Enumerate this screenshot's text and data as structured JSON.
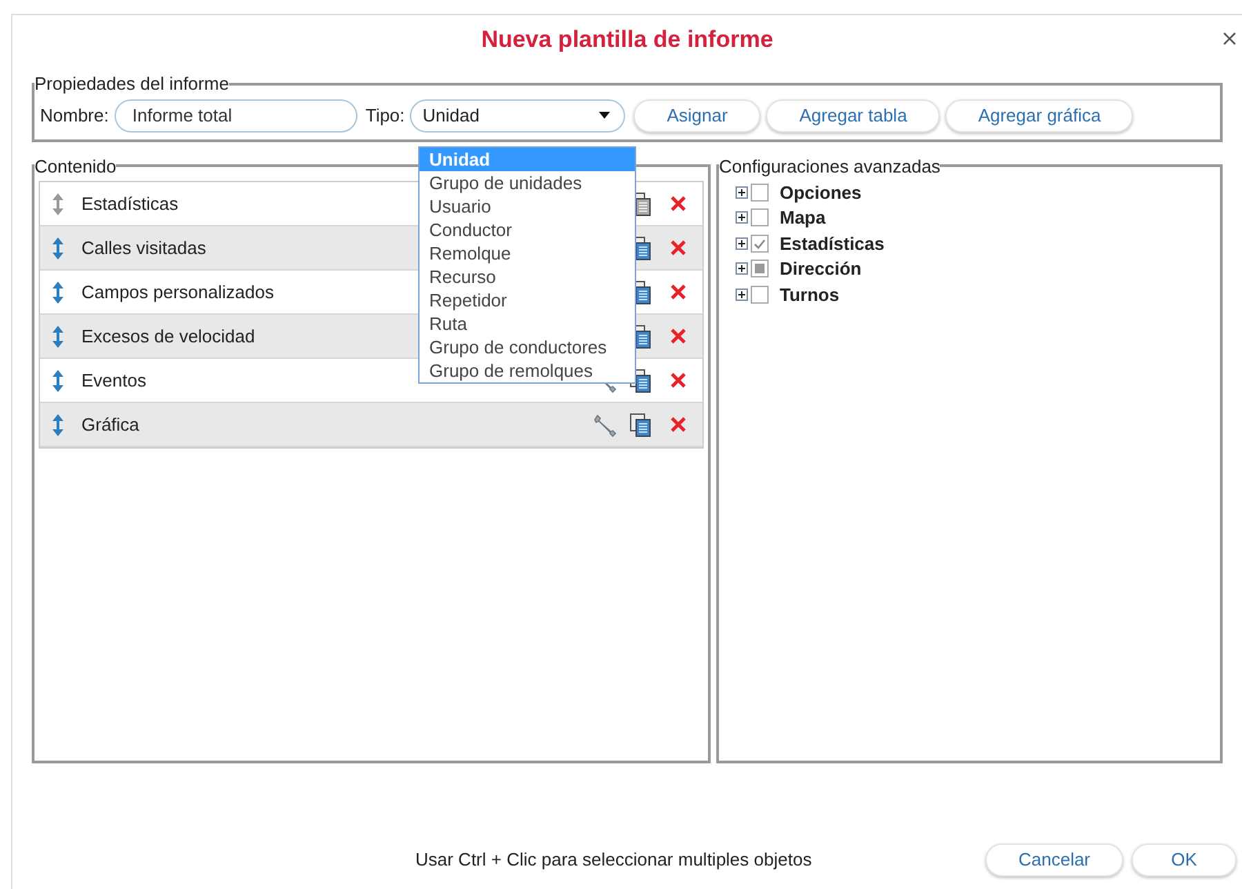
{
  "window": {
    "title": "Nueva plantilla de informe"
  },
  "properties": {
    "legend": "Propiedades del informe",
    "name_label": "Nombre:",
    "name_value": "Informe total",
    "type_label": "Tipo:",
    "type_value": "Unidad",
    "buttons": [
      "Asignar",
      "Agregar tabla",
      "Agregar gráfica"
    ]
  },
  "type_dropdown": {
    "expanded": true,
    "options": [
      {
        "label": "Unidad",
        "selected": true
      },
      {
        "label": "Grupo de unidades",
        "selected": false
      },
      {
        "label": "Usuario",
        "selected": false
      },
      {
        "label": "Conductor",
        "selected": false
      },
      {
        "label": "Remolque",
        "selected": false
      },
      {
        "label": "Recurso",
        "selected": false
      },
      {
        "label": "Repetidor",
        "selected": false
      },
      {
        "label": "Ruta",
        "selected": false
      },
      {
        "label": "Grupo de conductores",
        "selected": false
      },
      {
        "label": "Grupo de remolques",
        "selected": false
      }
    ]
  },
  "content": {
    "legend": "Contenido",
    "items": [
      {
        "label": "Estadísticas",
        "movable": false
      },
      {
        "label": "Calles visitadas",
        "movable": true
      },
      {
        "label": "Campos personalizados",
        "movable": true
      },
      {
        "label": "Excesos de velocidad",
        "movable": true
      },
      {
        "label": "Eventos",
        "movable": true
      },
      {
        "label": "Gráfica",
        "movable": true
      }
    ]
  },
  "advanced": {
    "legend": "Configuraciones avanzadas",
    "items": [
      {
        "label": "Opciones",
        "checked": false,
        "indeterminate": false
      },
      {
        "label": "Mapa",
        "checked": false,
        "indeterminate": false
      },
      {
        "label": "Estadísticas",
        "checked": true,
        "indeterminate": false
      },
      {
        "label": "Dirección",
        "checked": false,
        "indeterminate": true
      },
      {
        "label": "Turnos",
        "checked": false,
        "indeterminate": false
      }
    ]
  },
  "footer": {
    "hint": "Usar Ctrl + Clic para seleccionar multiples objetos",
    "buttons": [
      "Cancelar",
      "OK"
    ]
  }
}
